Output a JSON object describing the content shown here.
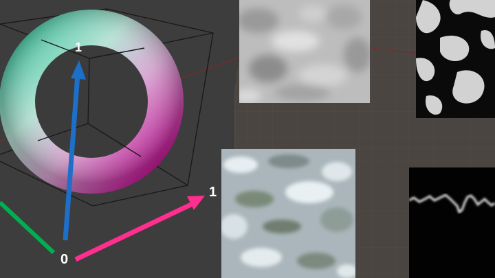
{
  "viewport": {
    "axis_labels": {
      "origin": "0",
      "x_axis": "1",
      "z_axis": "1"
    },
    "colors": {
      "x_axis": "#ff2e8f",
      "y_axis": "#00b050",
      "z_axis": "#1e6fc7",
      "background": "#3b3b3b",
      "node_grid": "#4c4640"
    }
  },
  "texture_previews": [
    {
      "name": "cloud-noise",
      "description_icon": "noise-texture-icon"
    },
    {
      "name": "blob-threshold",
      "description_icon": "voronoi-texture-icon"
    },
    {
      "name": "bumpy-surface",
      "description_icon": "bump-texture-icon"
    },
    {
      "name": "waveform",
      "description_icon": "waveform-icon"
    }
  ]
}
